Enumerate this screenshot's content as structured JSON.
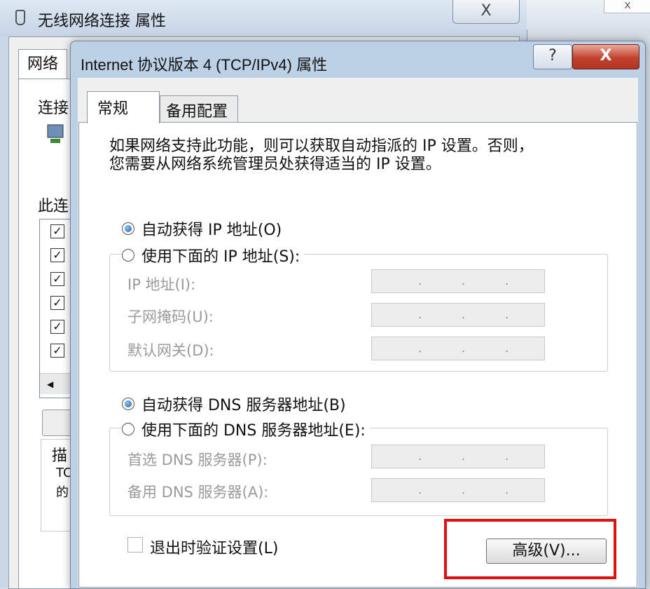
{
  "bg_window": {
    "title": "无线网络连接 属性",
    "close_glyph": "X",
    "tab_label": "网络",
    "label_connect": "连接",
    "label_this": "此连",
    "label_desc": "描",
    "label_desc_line2": "TC",
    "label_desc_line3": "的"
  },
  "dialog": {
    "title": "Internet 协议版本 4 (TCP/IPv4) 属性",
    "help_glyph": "?",
    "close_glyph": "X",
    "tabs": [
      "常规",
      "备用配置"
    ],
    "description_line1": "如果网络支持此功能，则可以获取自动指派的 IP 设置。否则，",
    "description_line2": "您需要从网络系统管理员处获得适当的 IP 设置。",
    "ip_auto": "自动获得 IP 地址(O)",
    "ip_manual": "使用下面的 IP 地址(S):",
    "ip_fields": [
      "IP 地址(I):",
      "子网掩码(U):",
      "默认网关(D):"
    ],
    "dns_auto": "自动获得 DNS 服务器地址(B)",
    "dns_manual": "使用下面的 DNS 服务器地址(E):",
    "dns_fields": [
      "首选 DNS 服务器(P):",
      "备用 DNS 服务器(A):"
    ],
    "validate_label": "退出时验证设置(L)",
    "advanced_button": "高级(V)...",
    "ip_dot": "."
  },
  "state": {
    "ip_mode": "auto",
    "dns_mode": "auto",
    "validate_checked": false
  },
  "colors": {
    "highlight": "#e01010",
    "close_button": "#c2422c"
  }
}
